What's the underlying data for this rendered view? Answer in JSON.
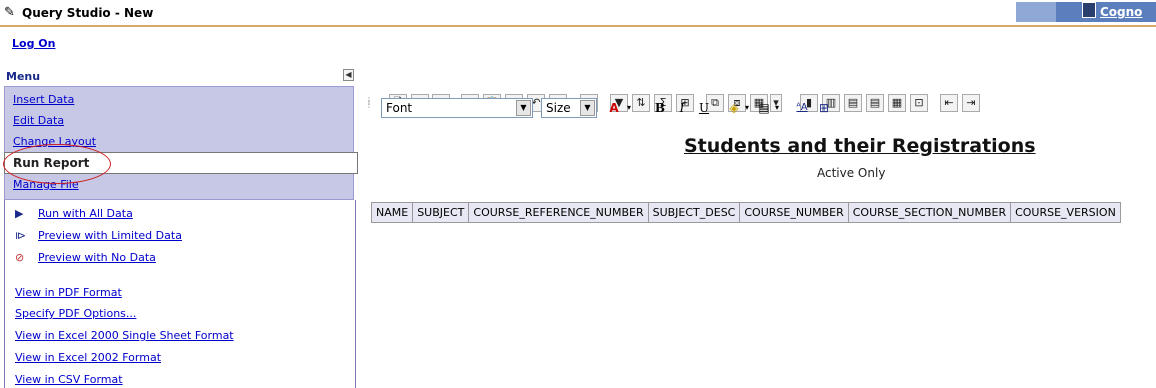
{
  "titlebar": {
    "title": "Query Studio - New",
    "brand": "Cogno"
  },
  "logon": "Log On",
  "menu": {
    "header": "Menu",
    "items": [
      "Insert Data",
      "Edit Data",
      "Change Layout",
      "Run Report",
      "Manage File"
    ]
  },
  "submenu": {
    "run_with_all": "Run with All Data",
    "preview_limited": "Preview with Limited Data",
    "preview_none": "Preview with No Data",
    "formats": [
      "View in PDF Format",
      "Specify PDF Options...",
      "View in Excel 2000 Single Sheet Format",
      "View in Excel 2002 Format",
      "View in CSV Format"
    ]
  },
  "toolbar": {
    "font_select": "Font",
    "size_select": "Size"
  },
  "report": {
    "title": "Students and their Registrations",
    "subtitle": "Active Only",
    "columns": [
      "NAME",
      "SUBJECT",
      "COURSE_REFERENCE_NUMBER",
      "SUBJECT_DESC",
      "COURSE_NUMBER",
      "COURSE_SECTION_NUMBER",
      "COURSE_VERSION"
    ]
  }
}
